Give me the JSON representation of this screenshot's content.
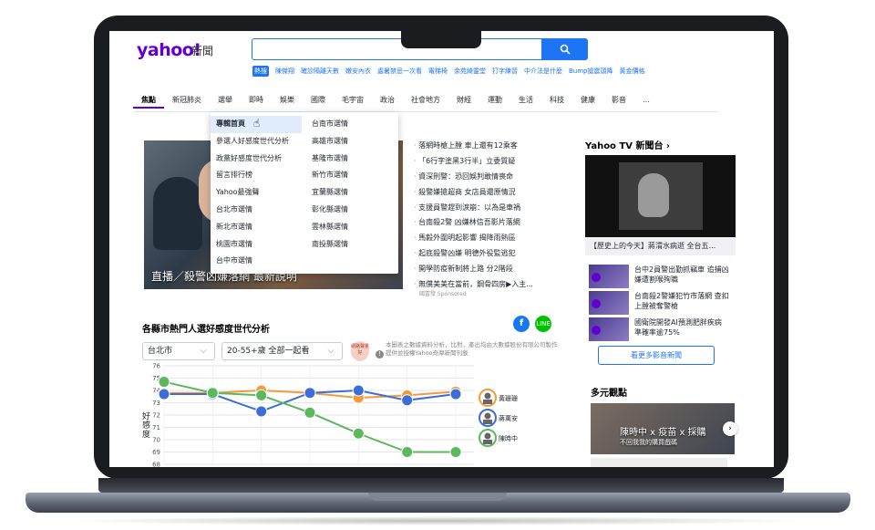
{
  "brand": {
    "logo": "yahoo!",
    "logo_sub": "新聞"
  },
  "search": {
    "placeholder": "",
    "button_icon": "search-icon"
  },
  "trending": {
    "tag": "熱搜",
    "items": [
      "陳傑翔",
      "確診隔離天數",
      "嫩安內衣",
      "處暑禁忌一次看",
      "電梯椅",
      "余苑綺靈堂",
      "打字練習",
      "中介法是什麼",
      "Bump搶震頭降",
      "黃金價格"
    ]
  },
  "nav": {
    "items": [
      "焦點",
      "新冠肺炎",
      "選舉",
      "即時",
      "娛樂",
      "國際",
      "毛宇宙",
      "政治",
      "社會地方",
      "財經",
      "運動",
      "生活",
      "科技",
      "健康",
      "影音",
      "…"
    ]
  },
  "dropdown": {
    "col1": [
      "專輯首頁",
      "參選人好感度世代分析",
      "政黨好感度世代分析",
      "留言排行榜",
      "Yahoo最強聲",
      "台北市選情",
      "新北市選情",
      "桃園市選情",
      "台中市選情"
    ],
    "col2": [
      "台南市選情",
      "高雄市選情",
      "基隆市選情",
      "新竹市選情",
      "宜蘭縣選情",
      "彰化縣選情",
      "雲林縣選情",
      "南投縣選情"
    ]
  },
  "hero": {
    "caption": "直播／殺警凶嫌落網 最新說明"
  },
  "headlines": [
    "落網時槍上膛 車上還有12乘客",
    "「6行字塗黑3行半」立委質疑",
    "資深刑警：恐回娛判敢情喪命",
    "殺警嫌搶超商 女店員還原情況",
    "支援員警趕到淚崩：以為是車禍",
    "台南殺2警 凶嫌林信吾影片落網",
    "馬毅外圍明起影響 揭降雨熱區",
    "起底殺警凶嫌 明德外役監逃犯",
    "開學防疫新制將上路 分2階段",
    "無償美美在當前，鋼骨四房▶入主..."
  ],
  "sponsor": "國富發 Sponsored",
  "analysis": {
    "title": "各縣市熱門人選好感度世代分析",
    "city_select": "台北市",
    "age_select": "20-55+歲 全部一起看",
    "badge": "網路聲量好",
    "note": "本圖表之數據資料分析，比對，產出均由大數據股份有限公司製作提供並授權Yahoo奇摩新聞刊載",
    "ylabel": "好感度"
  },
  "chart_data": {
    "type": "line",
    "title": "各縣市熱門人選好感度世代分析",
    "ylabel": "好感度",
    "ylim": [
      68,
      76
    ],
    "yticks": [
      68,
      69,
      70,
      71,
      72,
      73,
      74,
      75,
      76
    ],
    "x": [
      1,
      2,
      3,
      4,
      5,
      6,
      7
    ],
    "series": [
      {
        "name": "黃珊珊",
        "color": "#f39a3c",
        "values": [
          73.8,
          73.8,
          74,
          73.8,
          73.4,
          73.6,
          73.9
        ]
      },
      {
        "name": "蔣萬安",
        "color": "#3b6ed6",
        "values": [
          73.7,
          73.7,
          72.3,
          73.8,
          74,
          73.2,
          73.7
        ]
      },
      {
        "name": "陳時中",
        "color": "#5cb85c",
        "values": [
          74.7,
          73.8,
          73.6,
          72.2,
          70.5,
          69,
          69
        ]
      }
    ]
  },
  "tv": {
    "title": "Yahoo TV 新聞台 ›",
    "caption": "【歷史上的今天】蔣渭水病逝 全台五...",
    "videos": [
      "台中2員警出勤抓竊車 追捕凶嫌遭割喉殉職",
      "台南殺2警嫌犯竹市落網 查扣上膛被奪警槍",
      "國衛院開發AI預測肥胖疾病 準確率逾75%"
    ],
    "more": "看更多影音新聞"
  },
  "multi": {
    "title": "多元觀點",
    "caption": "陳時中 x 疫苗 x 採購",
    "sub": "不回我我的購買戲碼"
  }
}
